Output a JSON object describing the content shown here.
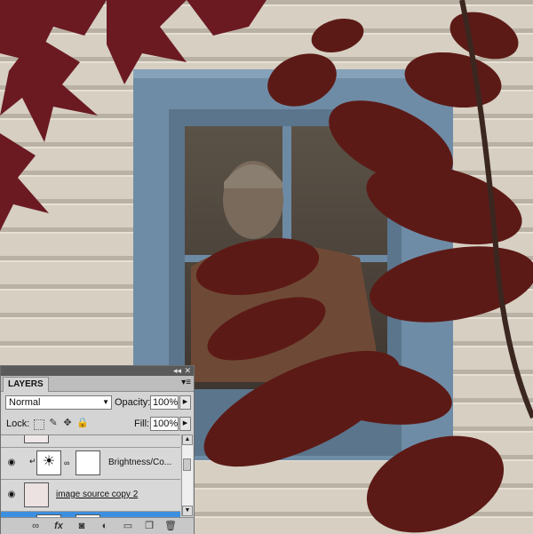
{
  "layers_panel": {
    "tab_label": "LAYERS",
    "blend_mode": "Normal",
    "opacity_label": "Opacity:",
    "opacity_value": "100%",
    "lock_label": "Lock:",
    "fill_label": "Fill:",
    "fill_value": "100%",
    "layers": [
      {
        "name": "",
        "selected": false
      },
      {
        "name": "Brightness/Co...",
        "selected": false
      },
      {
        "name": "image source copy 2",
        "selected": false
      },
      {
        "name": "",
        "selected": true
      }
    ]
  },
  "icons": {
    "panel_collapse": "double-chevron-icon",
    "panel_close": "close-icon",
    "panel_menu": "panel-menu-icon",
    "lock_icons": [
      "lock-transparent-icon",
      "lock-image-icon",
      "lock-position-icon",
      "lock-all-icon"
    ],
    "bottom_icons": [
      "link-layers-icon",
      "fx-icon",
      "add-mask-icon",
      "adjustment-layer-icon",
      "new-group-icon",
      "new-layer-icon",
      "trash-icon"
    ]
  },
  "colors": {
    "panel_bg": "#d4d4d4",
    "selection": "#3c8fe0",
    "siding": "#d3cbbd",
    "window_frame": "#6d8aa4",
    "leaves": "#6b1a1e"
  }
}
